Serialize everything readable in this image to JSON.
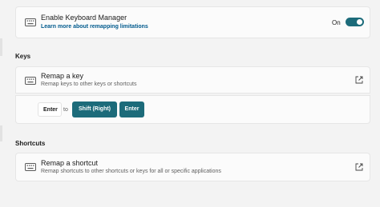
{
  "keyboard_manager": {
    "title": "Enable Keyboard Manager",
    "link": "Learn more about remapping limitations",
    "toggle_label": "On",
    "toggle_on": true
  },
  "keys_section": {
    "heading": "Keys",
    "title": "Remap a key",
    "description": "Remap keys to other keys or shortcuts",
    "mapping": {
      "source": "Enter",
      "to_word": "to",
      "targets": [
        "Shift (Right)",
        "Enter"
      ]
    }
  },
  "shortcuts_section": {
    "heading": "Shortcuts",
    "title": "Remap a shortcut",
    "description": "Remap shortcuts to other shortcuts or keys for all or specific applications"
  },
  "colors": {
    "accent": "#1c6b7a",
    "background": "#f3f3f3",
    "card": "#fbfbfb",
    "link": "#005a8d"
  },
  "icons": {
    "keyboard": "keyboard-icon",
    "open_external": "open-external-icon"
  }
}
